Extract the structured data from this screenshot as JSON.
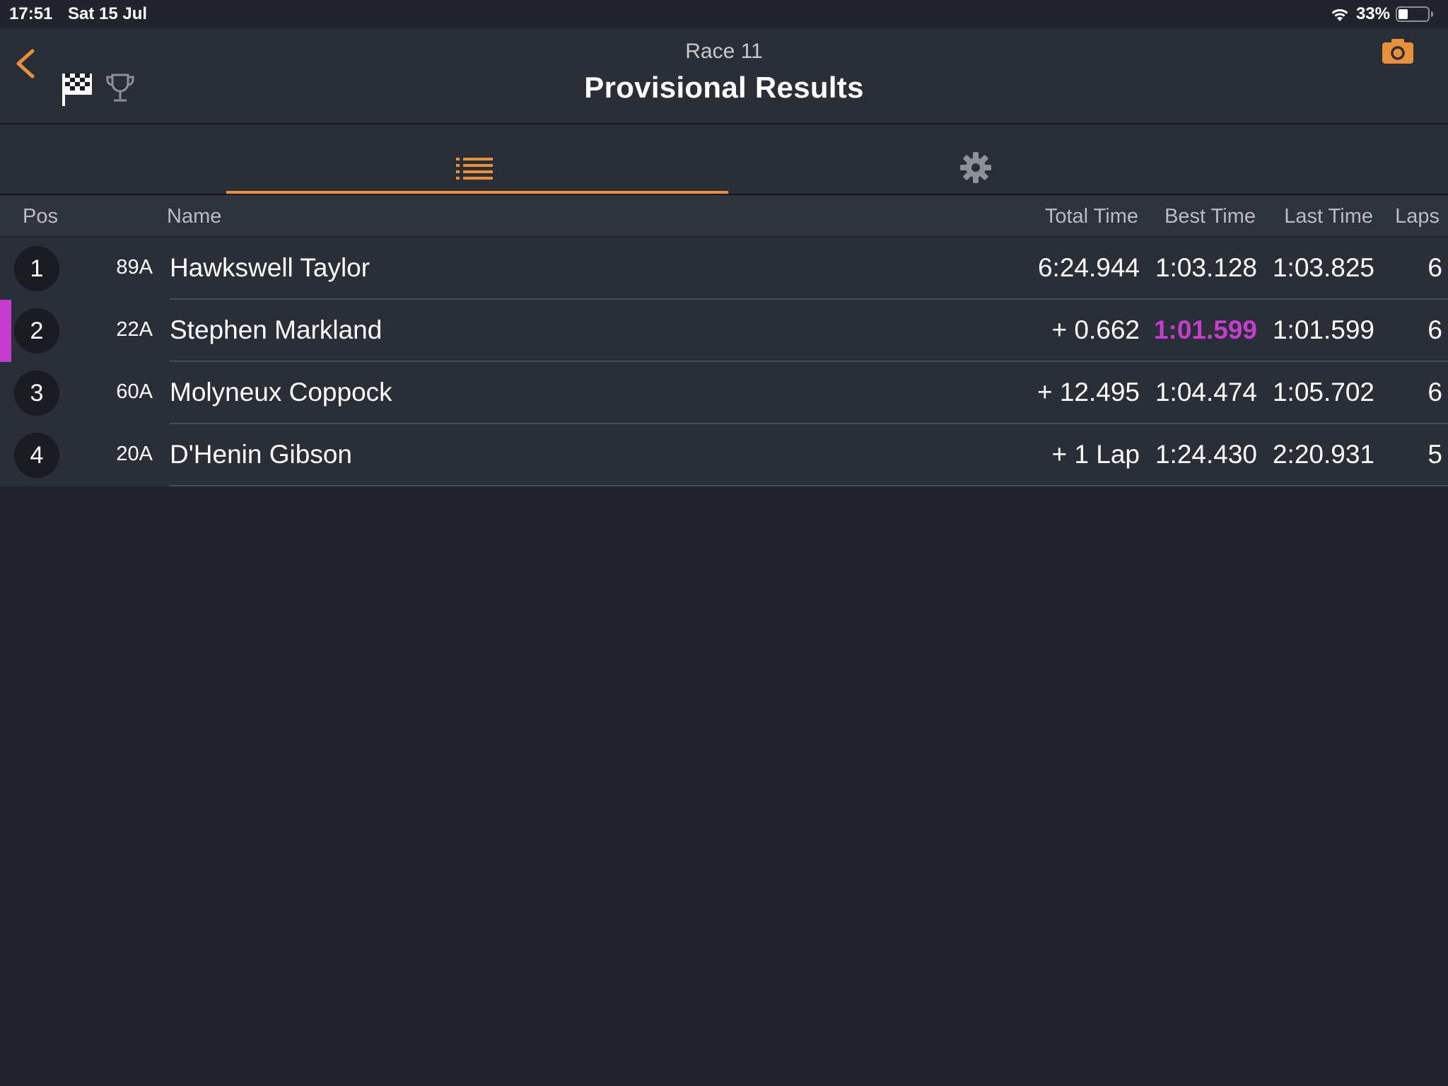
{
  "status_bar": {
    "time": "17:51",
    "date": "Sat 15 Jul",
    "battery": "33%"
  },
  "header": {
    "subtitle": "Race 11",
    "title": "Provisional Results",
    "back_icon": "chevron-left-icon",
    "camera_icon": "camera-icon",
    "flag_icon": "checkered-flag-icon",
    "trophy_icon": "trophy-icon"
  },
  "tabs": [
    {
      "icon": "list-icon",
      "selected": true
    },
    {
      "icon": "gear-icon",
      "selected": false
    }
  ],
  "table": {
    "headers": {
      "pos": "Pos",
      "name": "Name",
      "total": "Total Time",
      "best": "Best Time",
      "last": "Last Time",
      "laps": "Laps"
    },
    "rows": [
      {
        "pos": "1",
        "kart": "89A",
        "name": "Hawkswell Taylor",
        "total": "6:24.944",
        "best": "1:03.128",
        "last": "1:03.825",
        "laps": "6"
      },
      {
        "pos": "2",
        "kart": "22A",
        "name": "Stephen Markland",
        "total": "+ 0.662",
        "best": "1:01.599",
        "last": "1:01.599",
        "laps": "6",
        "fastest_lap": true
      },
      {
        "pos": "3",
        "kart": "60A",
        "name": "Molyneux Coppock",
        "total": "+ 12.495",
        "best": "1:04.474",
        "last": "1:05.702",
        "laps": "6"
      },
      {
        "pos": "4",
        "kart": "20A",
        "name": "D'Henin Gibson",
        "total": "+ 1 Lap",
        "best": "1:24.430",
        "last": "2:20.931",
        "laps": "5"
      }
    ]
  },
  "colors": {
    "accent": "#e8913a",
    "fastest": "#c43dcf",
    "background": "#21242c",
    "panel": "#2a2e37"
  }
}
